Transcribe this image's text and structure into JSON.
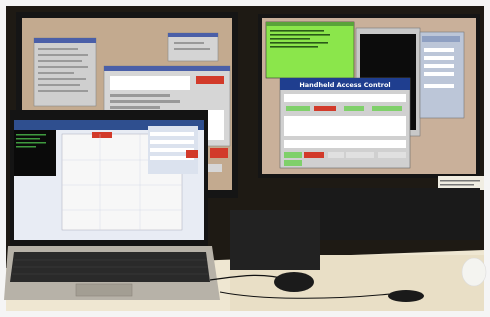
{
  "scene": {
    "right_monitor": {
      "dialog_title": "Handheld Access Control"
    }
  },
  "colors": {
    "wall_dark": "#1e1a14",
    "desk": "#efe7d2",
    "monitor_bezel": "#151515",
    "screen_tan": "#c3aa8f",
    "window_gray": "#c8c8c8",
    "title_blue": "#1f3e8f",
    "terminal_green": "#8be64b",
    "button_green": "#7fd06a",
    "button_red": "#d23a2a",
    "keyboard": "#2a2a2a",
    "laptop_silver": "#b7b2a8",
    "mouse": "#1b1b1b"
  }
}
